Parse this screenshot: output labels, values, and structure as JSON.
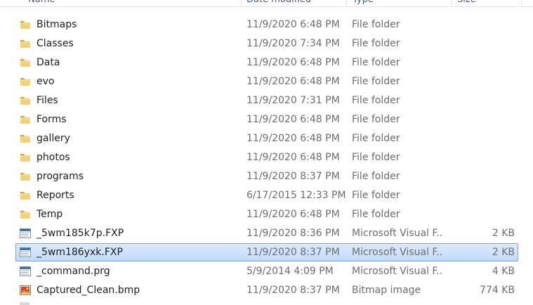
{
  "columns": {
    "name": "Name",
    "date": "Date modified",
    "type": "Type",
    "size": "Size"
  },
  "files": [
    {
      "name": "Bitmaps",
      "date": "11/9/2020 6:48 PM",
      "type": "File folder",
      "size": "",
      "icon": "folder-icon"
    },
    {
      "name": "Classes",
      "date": "11/9/2020 7:34 PM",
      "type": "File folder",
      "size": "",
      "icon": "folder-icon"
    },
    {
      "name": "Data",
      "date": "11/9/2020 6:48 PM",
      "type": "File folder",
      "size": "",
      "icon": "folder-icon"
    },
    {
      "name": "evo",
      "date": "11/9/2020 6:48 PM",
      "type": "File folder",
      "size": "",
      "icon": "folder-icon"
    },
    {
      "name": "Files",
      "date": "11/9/2020 7:31 PM",
      "type": "File folder",
      "size": "",
      "icon": "folder-icon"
    },
    {
      "name": "Forms",
      "date": "11/9/2020 6:48 PM",
      "type": "File folder",
      "size": "",
      "icon": "folder-icon"
    },
    {
      "name": "gallery",
      "date": "11/9/2020 6:48 PM",
      "type": "File folder",
      "size": "",
      "icon": "folder-icon"
    },
    {
      "name": "photos",
      "date": "11/9/2020 6:48 PM",
      "type": "File folder",
      "size": "",
      "icon": "folder-icon"
    },
    {
      "name": "programs",
      "date": "11/9/2020 8:37 PM",
      "type": "File folder",
      "size": "",
      "icon": "folder-icon"
    },
    {
      "name": "Reports",
      "date": "6/17/2015 12:33 PM",
      "type": "File folder",
      "size": "",
      "icon": "folder-icon"
    },
    {
      "name": "Temp",
      "date": "11/9/2020 6:48 PM",
      "type": "File folder",
      "size": "",
      "icon": "folder-icon"
    },
    {
      "name": "_5wm185k7p.FXP",
      "date": "11/9/2020 8:36 PM",
      "type": "Microsoft Visual F...",
      "size": "2 KB",
      "icon": "text-file-icon"
    },
    {
      "name": "_5wm186yxk.FXP",
      "date": "11/9/2020 8:37 PM",
      "type": "Microsoft Visual F...",
      "size": "2 KB",
      "icon": "text-file-icon",
      "selected": true
    },
    {
      "name": "_command.prg",
      "date": "5/9/2014 4:09 PM",
      "type": "Microsoft Visual F...",
      "size": "4 KB",
      "icon": "text-file-icon"
    },
    {
      "name": "Captured_Clean.bmp",
      "date": "11/9/2020 8:37 PM",
      "type": "Bitmap image",
      "size": "774 KB",
      "icon": "bitmap-file-icon"
    }
  ],
  "colors": {
    "folder": "#e8c35a",
    "selection_fill": "#c9e0fc",
    "selection_border": "#7da2ce"
  }
}
